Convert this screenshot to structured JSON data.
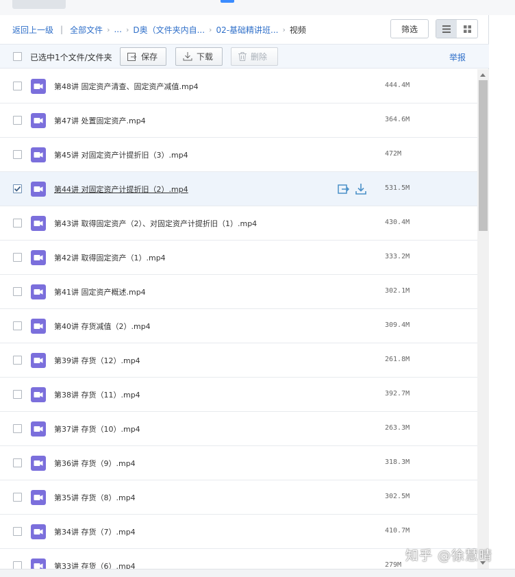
{
  "nav": {
    "back": "返回上一级",
    "all_files": "全部文件",
    "breadcrumb": [
      {
        "label": "..."
      },
      {
        "label": "D奥（文件夹内自..."
      },
      {
        "label": "02-基础精讲班..."
      }
    ],
    "current": "视频"
  },
  "toolbar": {
    "filter": "筛选",
    "view_modes": [
      {
        "icon": "list-view-icon",
        "active": true
      },
      {
        "icon": "grid-view-icon",
        "active": false
      }
    ]
  },
  "actions": {
    "selected_text": "已选中1个文件/文件夹",
    "save": "保存",
    "download": "下载",
    "delete": "删除",
    "report": "举报"
  },
  "files": [
    {
      "name": "第48讲 固定资产清查、固定资产减值.mp4",
      "size": "444.4M",
      "checked": false
    },
    {
      "name": "第47讲 处置固定资产.mp4",
      "size": "364.6M",
      "checked": false
    },
    {
      "name": "第45讲 对固定资产计提折旧（3）.mp4",
      "size": "472M",
      "checked": false
    },
    {
      "name": "第44讲 对固定资产计提折旧（2）.mp4",
      "size": "531.5M",
      "checked": true
    },
    {
      "name": "第43讲 取得固定资产（2）、对固定资产计提折旧（1）.mp4",
      "size": "430.4M",
      "checked": false
    },
    {
      "name": "第42讲 取得固定资产（1）.mp4",
      "size": "333.2M",
      "checked": false
    },
    {
      "name": "第41讲 固定资产概述.mp4",
      "size": "302.1M",
      "checked": false
    },
    {
      "name": "第40讲 存货减值（2）.mp4",
      "size": "309.4M",
      "checked": false
    },
    {
      "name": "第39讲 存货（12）.mp4",
      "size": "261.8M",
      "checked": false
    },
    {
      "name": "第38讲 存货（11）.mp4",
      "size": "392.7M",
      "checked": false
    },
    {
      "name": "第37讲 存货（10）.mp4",
      "size": "263.3M",
      "checked": false
    },
    {
      "name": "第36讲 存货（9）.mp4",
      "size": "318.3M",
      "checked": false
    },
    {
      "name": "第35讲 存货（8）.mp4",
      "size": "302.5M",
      "checked": false
    },
    {
      "name": "第34讲 存货（7）.mp4",
      "size": "410.7M",
      "checked": false
    },
    {
      "name": "第33讲 存货（6）.mp4",
      "size": "279M",
      "checked": false
    }
  ],
  "watermark": "知乎 @徐慧晴",
  "colors": {
    "link": "#2f6fc9",
    "video_icon": "#7b6fdc",
    "row_action": "#4a90c8",
    "selected_row": "#eef4fb"
  }
}
